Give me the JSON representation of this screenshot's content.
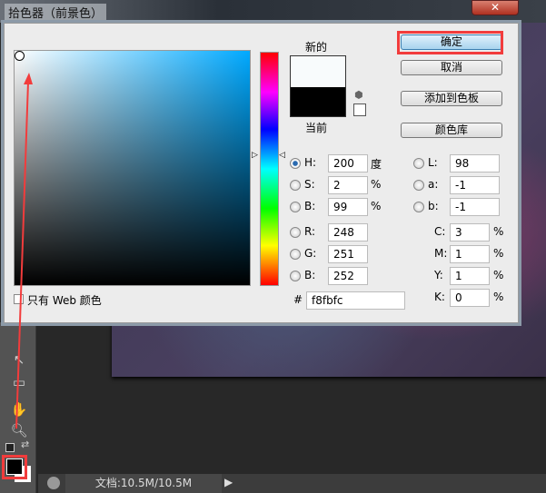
{
  "dialog": {
    "title": "拾色器（前景色）",
    "close": "✕"
  },
  "swatch": {
    "new_label": "新的",
    "current_label": "当前",
    "new_color": "#f8fbfc",
    "current_color": "#000000"
  },
  "buttons": {
    "ok": "确定",
    "cancel": "取消",
    "add_swatch": "添加到色板",
    "libraries": "颜色库"
  },
  "web_only": {
    "label": "只有 Web 颜色",
    "checked": false
  },
  "hsb": [
    {
      "label": "H:",
      "value": "200",
      "unit": "度",
      "selected": true
    },
    {
      "label": "S:",
      "value": "2",
      "unit": "%"
    },
    {
      "label": "B:",
      "value": "99",
      "unit": "%"
    }
  ],
  "rgb": [
    {
      "label": "R:",
      "value": "248"
    },
    {
      "label": "G:",
      "value": "251"
    },
    {
      "label": "B:",
      "value": "252"
    }
  ],
  "lab": [
    {
      "label": "L:",
      "value": "98"
    },
    {
      "label": "a:",
      "value": "-1"
    },
    {
      "label": "b:",
      "value": "-1"
    }
  ],
  "cmyk": [
    {
      "label": "C:",
      "value": "3",
      "unit": "%"
    },
    {
      "label": "M:",
      "value": "1",
      "unit": "%"
    },
    {
      "label": "Y:",
      "value": "1",
      "unit": "%"
    },
    {
      "label": "K:",
      "value": "0",
      "unit": "%"
    }
  ],
  "hex": {
    "label": "#",
    "value": "f8fbfc"
  },
  "status": {
    "doc": "文档:10.5M/10.5M"
  },
  "colors": {
    "annotation": "#f23c3c",
    "foreground": "#000000",
    "background": "#ffffff"
  }
}
